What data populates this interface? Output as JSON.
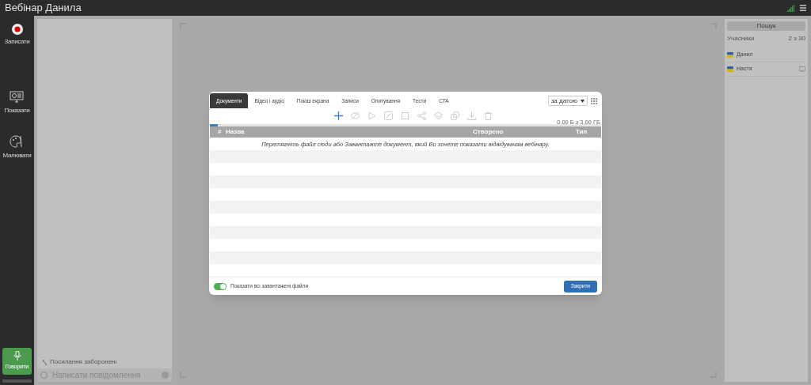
{
  "window": {
    "title": "Вебінар Данила"
  },
  "sidebar": {
    "items": [
      {
        "kind": "record",
        "label": "Записати"
      },
      {
        "kind": "show",
        "label": "Показати"
      },
      {
        "kind": "draw",
        "label": "Малювати"
      }
    ],
    "speak_button": "Говорити"
  },
  "chat": {
    "notice": "Посилання заборонені",
    "placeholder": "Написати повідомлення"
  },
  "participants": {
    "search_button": "Пошук",
    "label": "Учасники",
    "count": "2 з 30",
    "items": [
      {
        "name": "Данил",
        "screen": false
      },
      {
        "name": "Настя",
        "screen": true
      }
    ]
  },
  "dialog": {
    "tabs": [
      {
        "label": "Документи",
        "selected": true
      },
      {
        "label": "Відео і аудіо",
        "selected": false
      },
      {
        "label": "Показ екрана",
        "selected": false
      },
      {
        "label": "Записи",
        "selected": false
      },
      {
        "label": "Опитування",
        "selected": false
      },
      {
        "label": "Тести",
        "selected": false
      },
      {
        "label": "CTA",
        "selected": false
      }
    ],
    "sort": "за датою",
    "storage": {
      "text": "0.00 Б з 3.00 ГБ",
      "level": 0.02
    },
    "table": {
      "columns": [
        "#",
        "Назва",
        "Створено",
        "Тип"
      ],
      "empty_message": "Перетягніть файл сюди або Завантажте документ, який Ви хочете показати відвідувачам вебінару."
    },
    "toggle": {
      "label": "Показати всі завантажені файли",
      "on": true
    },
    "close_button": "Закрити"
  }
}
